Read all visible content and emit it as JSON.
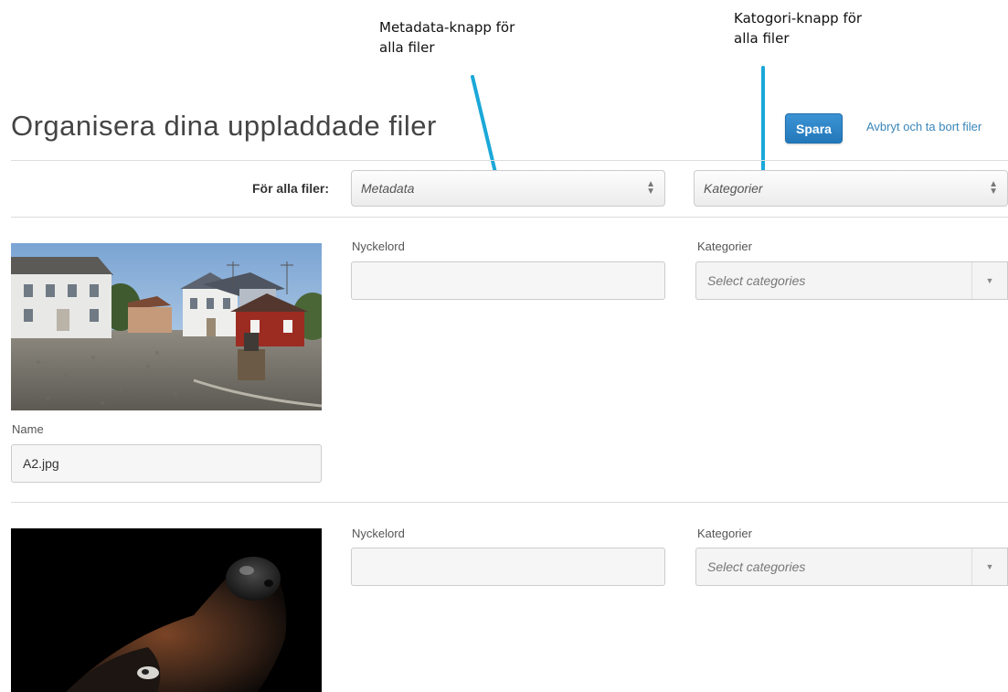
{
  "annotations": {
    "metadata_note": "Metadata-knapp för\nalla filer",
    "category_note": "Katogori-knapp för\nalla filer",
    "arrow_color": "#1aa8d8"
  },
  "header": {
    "title": "Organisera dina uppladdade filer",
    "save_label": "Spara",
    "cancel_label": "Avbryt och ta bort filer"
  },
  "bulk_row": {
    "label": "För alla filer:",
    "metadata_select": "Metadata",
    "category_select": "Kategorier"
  },
  "files": [
    {
      "thumbnail": "village-street-photo",
      "keywords_label": "Nyckelord",
      "keywords_value": "",
      "categories_label": "Kategorier",
      "categories_placeholder": "Select categories",
      "name_label": "Name",
      "name_value": "A2.jpg"
    },
    {
      "thumbnail": "dog-portrait-photo",
      "keywords_label": "Nyckelord",
      "keywords_value": "",
      "categories_label": "Kategorier",
      "categories_placeholder": "Select categories"
    }
  ],
  "colors": {
    "primary_button": "#2a80c2",
    "link": "#3a86b8"
  }
}
